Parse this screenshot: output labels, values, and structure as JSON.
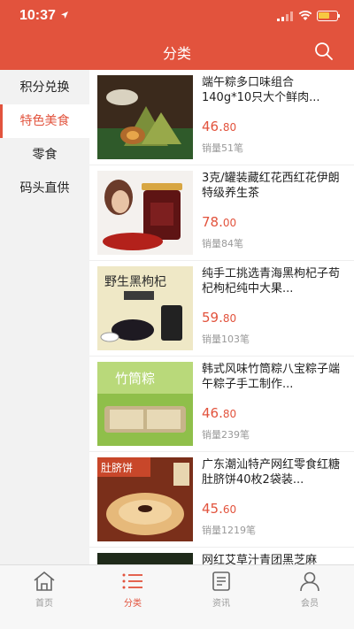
{
  "status_bar": {
    "time": "10:37"
  },
  "header": {
    "title": "分类",
    "search_icon": "search-icon"
  },
  "sidebar": {
    "items": [
      {
        "label": "积分兑换",
        "active": false
      },
      {
        "label": "特色美食",
        "active": true
      },
      {
        "label": "零食",
        "active": false
      },
      {
        "label": "码头直供",
        "active": false
      }
    ]
  },
  "colors": {
    "accent": "#e2533d",
    "sidebar_bg": "#f2f2f2",
    "muted": "#999999"
  },
  "products": [
    {
      "name": "端午粽多口味组合140g*10只大个鲜肉...",
      "price_int": "46.",
      "price_dec": "80",
      "sold": "销量51笔"
    },
    {
      "name": "3克/罐装藏红花西红花伊朗特级养生茶",
      "price_int": "78.",
      "price_dec": "00",
      "sold": "销量84笔"
    },
    {
      "name": "纯手工挑选青海黑枸杞子苟杞枸杞纯中大果...",
      "price_int": "59.",
      "price_dec": "80",
      "sold": "销量103笔"
    },
    {
      "name": "韩式风味竹筒粽八宝粽子端午粽子手工制作...",
      "price_int": "46.",
      "price_dec": "80",
      "sold": "销量239笔"
    },
    {
      "name": "广东潮汕特产网红零食红糖肚脐饼40枚2袋装...",
      "price_int": "45.",
      "price_dec": "60",
      "sold": "销量1219笔"
    },
    {
      "name": "网红艾草汁青团黑芝麻",
      "price_int": "",
      "price_dec": "",
      "sold": ""
    }
  ],
  "thumb_texts": {
    "p3": "野生黑枸杞",
    "p4": "竹筒粽",
    "p5": "肚脐饼"
  },
  "tabbar": {
    "tabs": [
      {
        "label": "首页",
        "icon": "home-icon",
        "active": false
      },
      {
        "label": "分类",
        "icon": "list-icon",
        "active": true
      },
      {
        "label": "资讯",
        "icon": "news-icon",
        "active": false
      },
      {
        "label": "会员",
        "icon": "user-icon",
        "active": false
      }
    ]
  }
}
